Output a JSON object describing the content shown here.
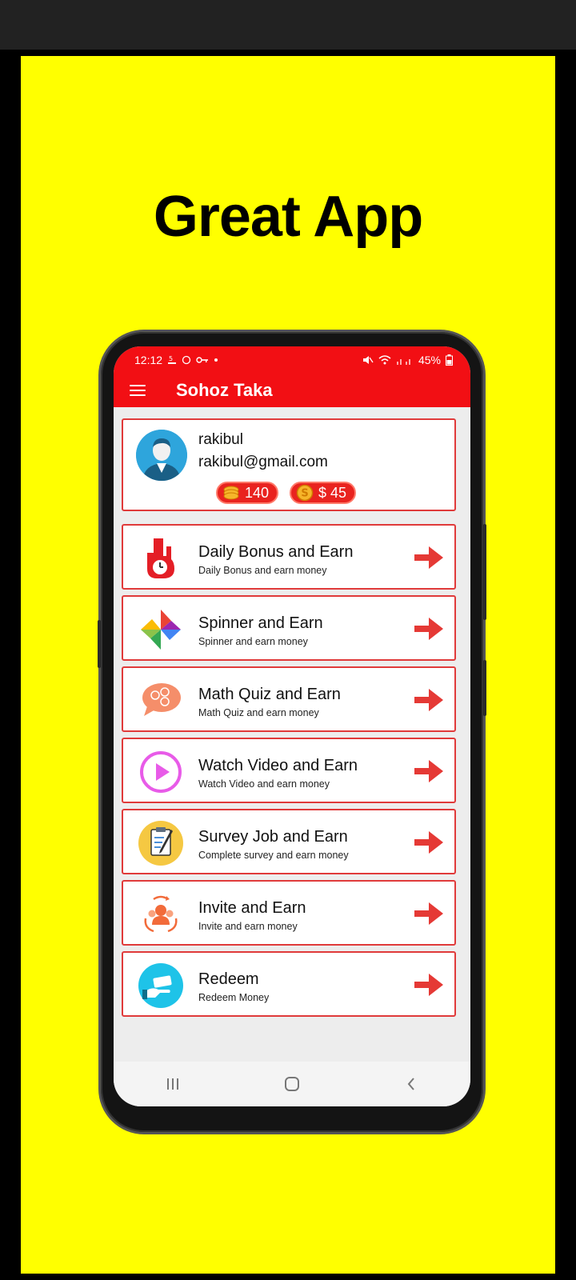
{
  "headline": "Great App",
  "status_bar": {
    "time": "12:12",
    "battery": "45%"
  },
  "app_bar": {
    "title": "Sohoz Taka"
  },
  "profile": {
    "name": "rakibul",
    "email": "rakibul@gmail.com",
    "coins": "140",
    "balance": "$ 45"
  },
  "menu": [
    {
      "title": "Daily Bonus and Earn",
      "subtitle": "Daily Bonus and earn money",
      "icon": "daily-bonus-icon"
    },
    {
      "title": "Spinner and Earn",
      "subtitle": "Spinner and earn money",
      "icon": "pinwheel-icon"
    },
    {
      "title": "Math Quiz and Earn",
      "subtitle": "Math Quiz and earn money",
      "icon": "math-quiz-icon"
    },
    {
      "title": "Watch Video and Earn",
      "subtitle": "Watch Video and earn money",
      "icon": "play-icon"
    },
    {
      "title": "Survey Job and Earn",
      "subtitle": "Complete survey and earn money",
      "icon": "clipboard-icon"
    },
    {
      "title": "Invite and Earn",
      "subtitle": "Invite and earn money",
      "icon": "invite-icon"
    },
    {
      "title": "Redeem",
      "subtitle": "Redeem Money",
      "icon": "redeem-icon"
    }
  ],
  "colors": {
    "background": "#FFFF00",
    "app_red": "#F20F14",
    "card_border": "#E03A3A",
    "arrow": "#E53935"
  }
}
